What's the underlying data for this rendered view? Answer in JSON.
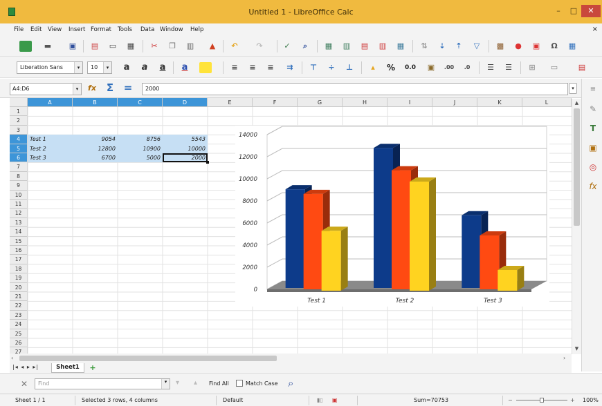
{
  "window": {
    "title": "Untitled 1 - LibreOffice Calc",
    "minimize": "–",
    "maximize": "□",
    "close": "✕",
    "doc_close": "×"
  },
  "menu": [
    "File",
    "Edit",
    "View",
    "Insert",
    "Format",
    "Tools",
    "Data",
    "Window",
    "Help"
  ],
  "format_bar": {
    "font_name": "Liberation Sans",
    "font_size": "10",
    "currency": "%",
    "decimal": "0.0"
  },
  "formula_bar": {
    "name_box": "A4:D6",
    "function_wizard": "fx",
    "sum": "Σ",
    "equals": "=",
    "content": "2000"
  },
  "columns": [
    "A",
    "B",
    "C",
    "D",
    "E",
    "F",
    "G",
    "H",
    "I",
    "J",
    "K",
    "L"
  ],
  "rows": [
    "1",
    "2",
    "3",
    "4",
    "5",
    "6",
    "7",
    "8",
    "9",
    "10",
    "11",
    "12",
    "13",
    "14",
    "15",
    "16",
    "17",
    "18",
    "19",
    "20",
    "21",
    "22",
    "23",
    "24",
    "25",
    "26",
    "27"
  ],
  "table": [
    {
      "label": "Test 1",
      "b": "9054",
      "c": "8756",
      "d": "5543"
    },
    {
      "label": "Test 2",
      "b": "12800",
      "c": "10900",
      "d": "10000"
    },
    {
      "label": "Test 3",
      "b": "6700",
      "c": "5000",
      "d": "2000"
    }
  ],
  "chart_data": {
    "type": "bar",
    "categories": [
      "Test 1",
      "Test 2",
      "Test 3"
    ],
    "series": [
      {
        "values": [
          9054,
          12800,
          6700
        ],
        "color": "#0d3b8a"
      },
      {
        "values": [
          8756,
          10900,
          5000
        ],
        "color": "#ff4a12"
      },
      {
        "values": [
          5543,
          10000,
          2000
        ],
        "color": "#ffd320"
      }
    ],
    "yticks": [
      0,
      2000,
      4000,
      6000,
      8000,
      10000,
      12000,
      14000
    ],
    "ylim": [
      0,
      14000
    ],
    "grid": true,
    "style": "3d-column"
  },
  "sheets": {
    "active": "Sheet1",
    "add": "+"
  },
  "find": {
    "placeholder": "Find",
    "find_all": "Find All",
    "match_case": "Match Case"
  },
  "status": {
    "sheet": "Sheet 1 / 1",
    "selection": "Selected 3 rows, 4 columns",
    "style": "Default",
    "sum": "Sum=70753",
    "zoom": "100%"
  }
}
